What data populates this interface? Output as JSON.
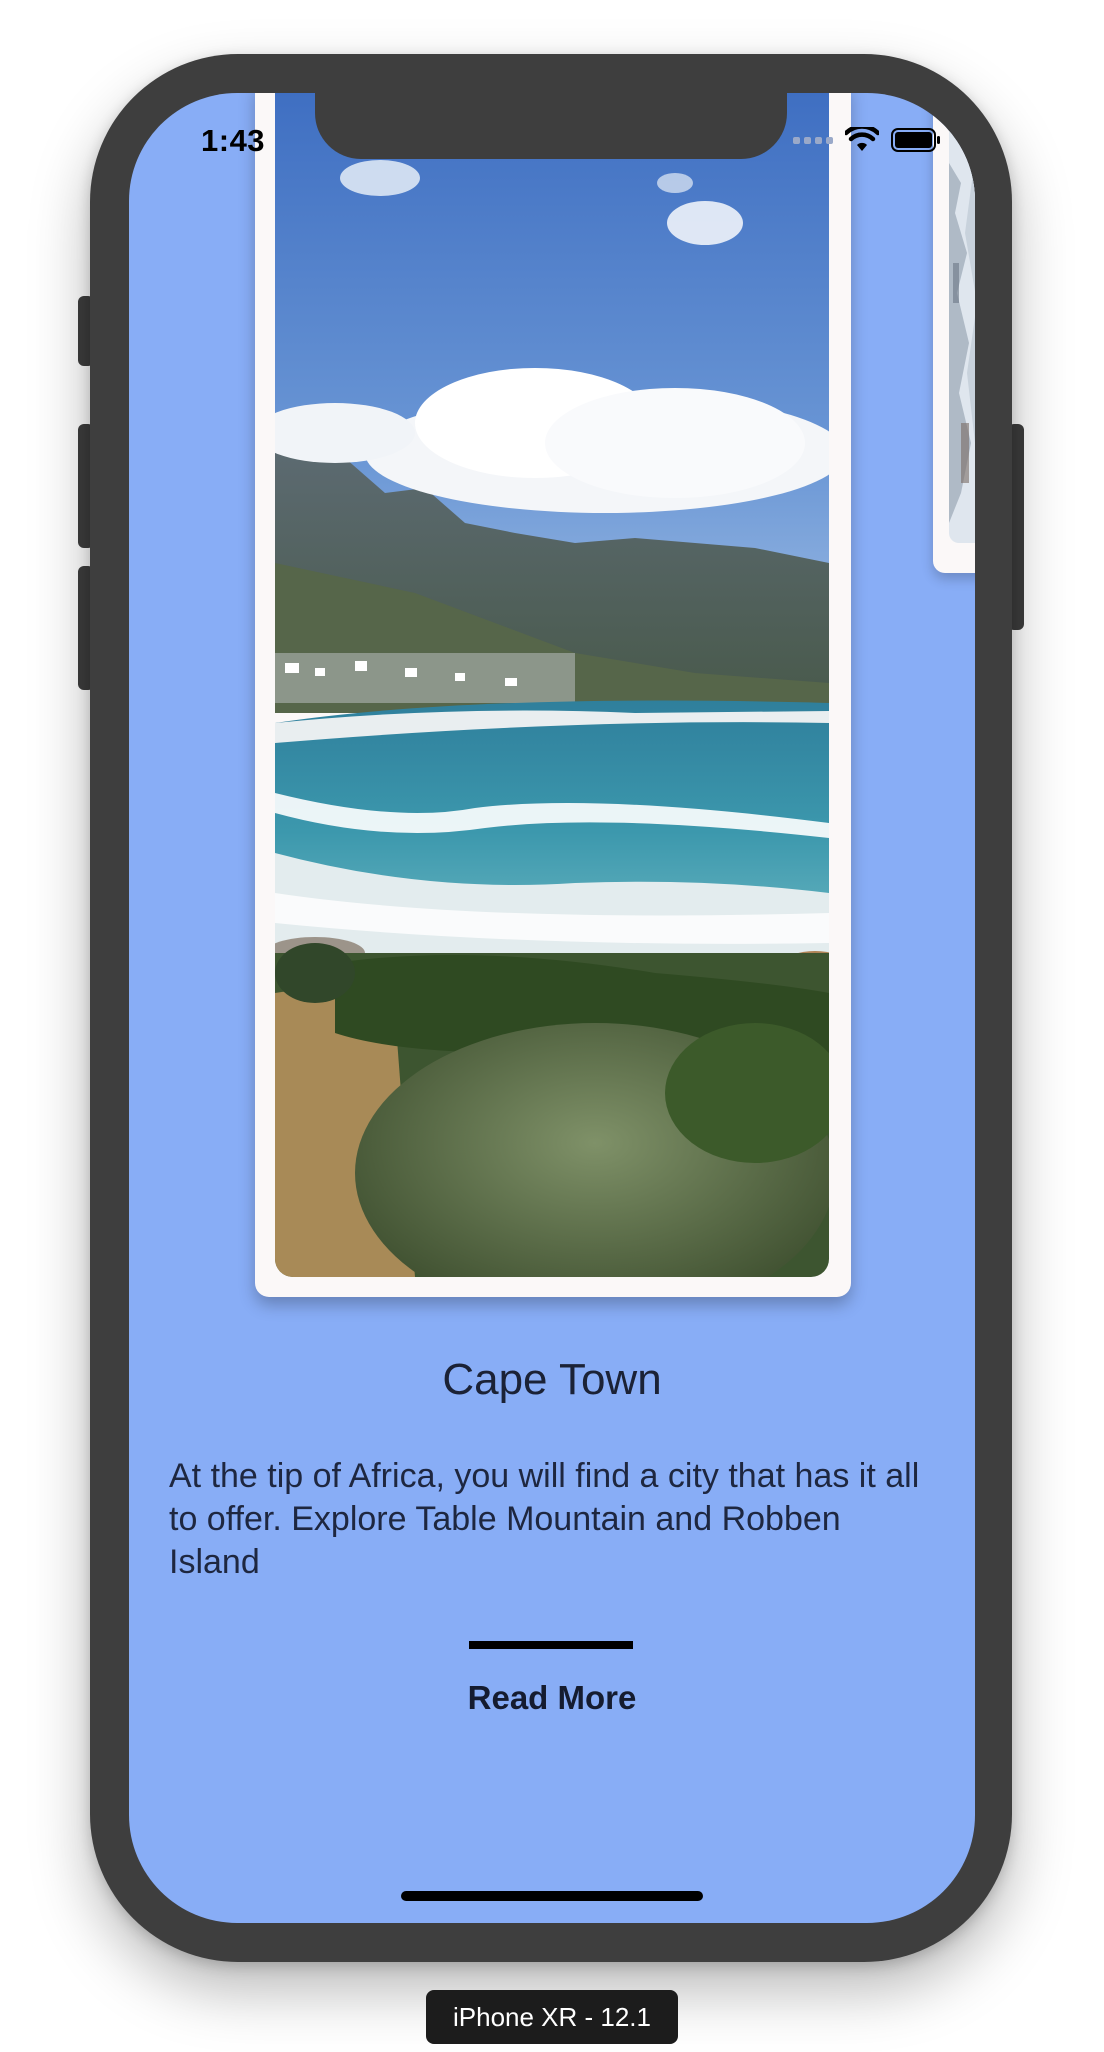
{
  "status_bar": {
    "time": "1:43",
    "icons": [
      "cellular-signal-icon",
      "wifi-icon",
      "battery-icon"
    ]
  },
  "carousel": {
    "current_card": {
      "image": "cape-town-coastline-photo",
      "title": "Cape Town",
      "description": "At the tip of Africa, you will find a city that has it all to offer. Explore Table Mountain and Robben Island",
      "cta_label": "Read More"
    },
    "next_card": {
      "image": "snowy-landscape-photo"
    }
  },
  "device": {
    "label": "iPhone XR - 12.1"
  },
  "colors": {
    "screen_background": "#88adf6",
    "frame": "#3e3e3e",
    "card_background": "#fbf8f8",
    "text": "#1b2236"
  }
}
